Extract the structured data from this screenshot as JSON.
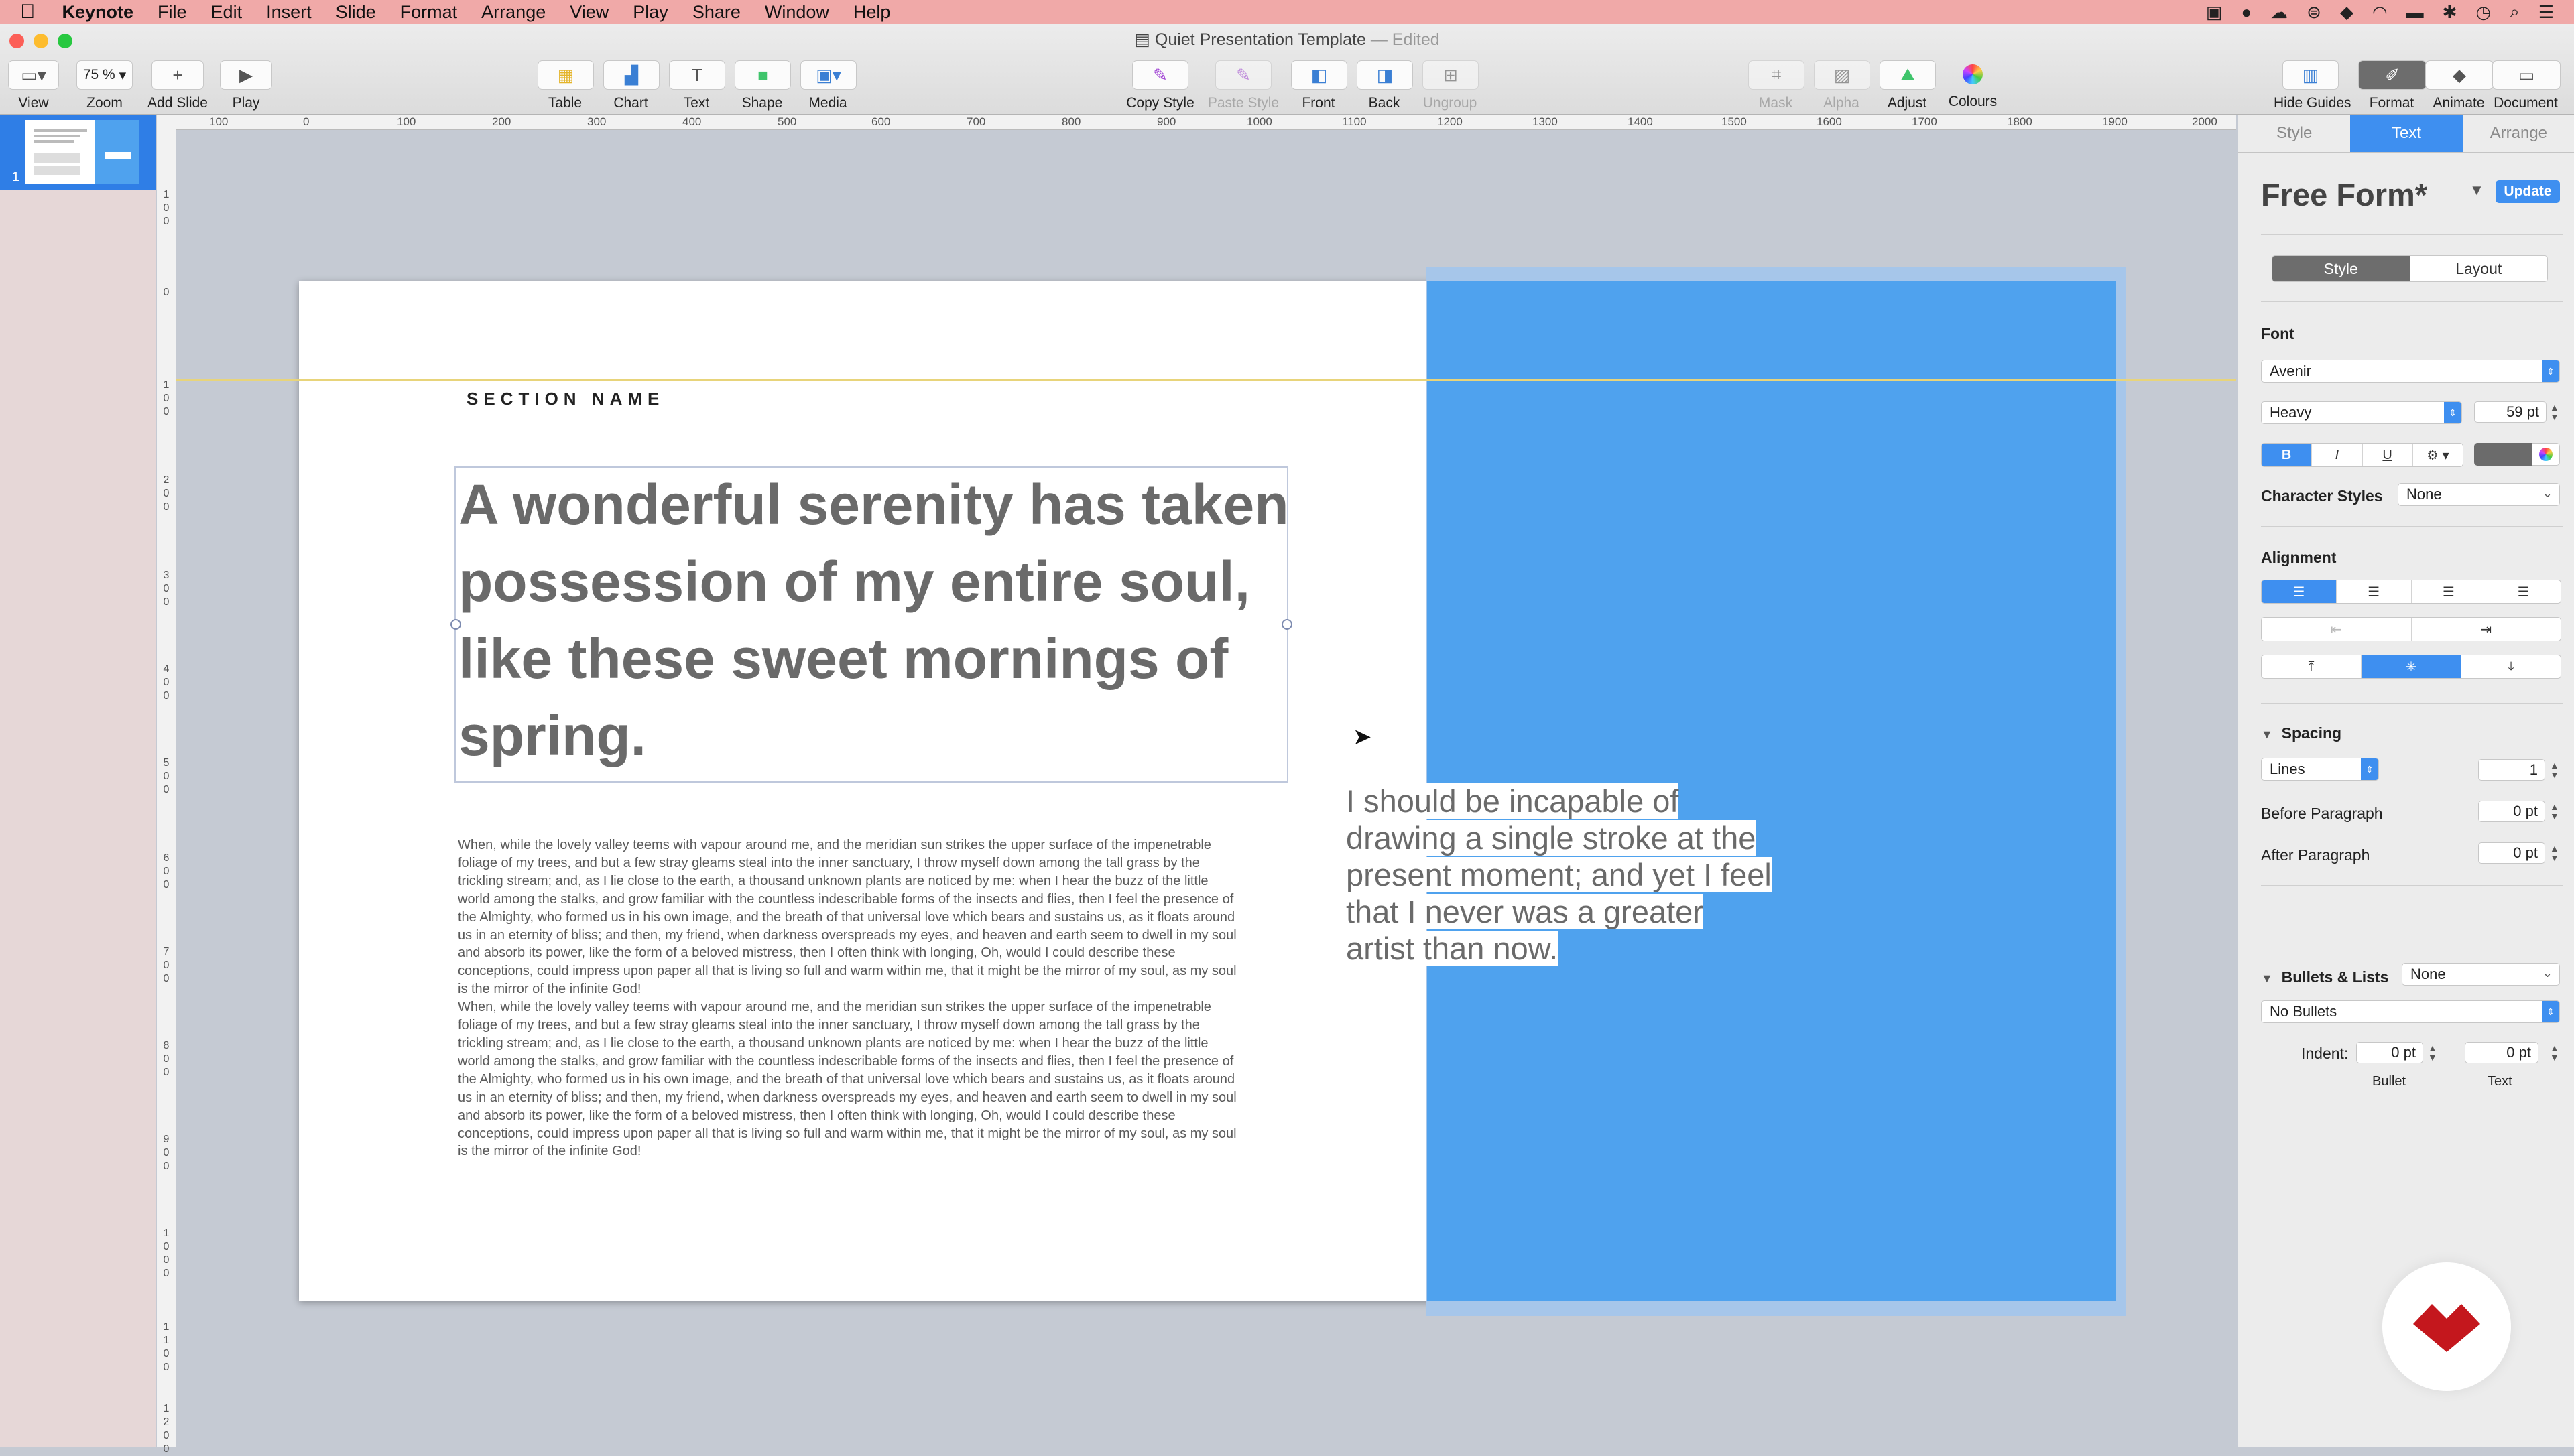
{
  "menubar": {
    "app_name": "Keynote",
    "items": [
      "File",
      "Edit",
      "Insert",
      "Slide",
      "Format",
      "Arrange",
      "View",
      "Play",
      "Share",
      "Window",
      "Help"
    ]
  },
  "window": {
    "title": "Quiet Presentation Template",
    "edited": "— Edited"
  },
  "toolbar": {
    "view": "View",
    "zoom": "Zoom",
    "zoom_value": "75 %",
    "add_slide": "Add Slide",
    "play": "Play",
    "table": "Table",
    "chart": "Chart",
    "text": "Text",
    "shape": "Shape",
    "media": "Media",
    "copy_style": "Copy Style",
    "paste_style": "Paste Style",
    "front": "Front",
    "back": "Back",
    "ungroup": "Ungroup",
    "mask": "Mask",
    "alpha": "Alpha",
    "adjust": "Adjust",
    "colours": "Colours",
    "hide_guides": "Hide Guides",
    "format": "Format",
    "animate": "Animate",
    "document": "Document",
    "text_glyph": "T"
  },
  "navigator": {
    "slide_number": "1"
  },
  "rulers": {
    "h_ticks": [
      "100",
      "0",
      "100",
      "200",
      "300",
      "400",
      "500",
      "600",
      "700",
      "800",
      "900",
      "1000",
      "1100",
      "1200",
      "1300",
      "1400",
      "1500",
      "1600",
      "1700",
      "1800",
      "1900",
      "2000"
    ],
    "v_ticks": [
      "100",
      "0",
      "100",
      "200",
      "300",
      "400",
      "500",
      "600",
      "700",
      "800",
      "900",
      "1000",
      "1100",
      "1200"
    ]
  },
  "slide": {
    "section_name": "SECTION NAME",
    "headline": "A wonderful serenity has taken possession of my entire soul, like these sweet mornings of spring.",
    "body_paragraphs": [
      "When, while the lovely valley teems with vapour around me, and the meridian sun strikes the upper surface of the impenetrable foliage of my trees, and but a few stray gleams steal into the inner sanctuary, I throw myself down among the tall grass by the trickling stream; and, as I lie close to the earth, a thousand unknown plants are noticed by me: when I hear the buzz of the little world among the stalks, and grow familiar with the countless indescribable forms of the insects and flies, then I feel the presence of the Almighty, who formed us in his own image, and the breath of that universal love which bears and sustains us, as it floats around us in an eternity of bliss; and then, my friend, when darkness overspreads my eyes, and heaven and earth seem to dwell in my soul and absorb its power, like the form of a beloved mistress, then I often think with longing, Oh, would I could describe these conceptions, could impress upon paper all that is living so full and warm within me, that it might be the mirror of my soul, as my soul is the mirror of the infinite God!",
      "When, while the lovely valley teems with vapour around me, and the meridian sun strikes the upper surface of the impenetrable foliage of my trees, and but a few stray gleams steal into the inner sanctuary, I throw myself down among the tall grass by the trickling stream; and, as I lie close to the earth, a thousand unknown plants are noticed by me: when I hear the buzz of the little world among the stalks, and grow familiar with the countless indescribable forms of the insects and flies, then I feel the presence of the Almighty, who formed us in his own image, and the breath of that universal love which bears and sustains us, as it floats around us in an eternity of bliss; and then, my friend, when darkness overspreads my eyes, and heaven and earth seem to dwell in my soul and absorb its power, like the form of a beloved mistress, then I often think with longing, Oh, would I could describe these conceptions, could impress upon paper all that is living so full and warm within me, that it might be the mirror of my soul, as my soul is the mirror of the infinite God!"
    ],
    "quote": "I should be incapable of drawing a single stroke at the present moment; and yet I feel that I never was a greater artist than now.",
    "accent_color": "#4fa2ee"
  },
  "inspector": {
    "tabs": [
      "Style",
      "Text",
      "Arrange"
    ],
    "active_tab": "Text",
    "paragraph_style": "Free Form*",
    "update_button": "Update",
    "subtabs": [
      "Style",
      "Layout"
    ],
    "font_label": "Font",
    "font_family": "Avenir",
    "font_weight": "Heavy",
    "font_size": "59 pt",
    "bold": "B",
    "italic": "I",
    "underline": "U",
    "gear": "⚙",
    "character_styles_label": "Character Styles",
    "character_styles_value": "None",
    "alignment_label": "Alignment",
    "spacing_label": "Spacing",
    "spacing_mode": "Lines",
    "spacing_value": "1",
    "before_paragraph_label": "Before Paragraph",
    "before_paragraph_value": "0 pt",
    "after_paragraph_label": "After Paragraph",
    "after_paragraph_value": "0 pt",
    "bullets_label": "Bullets & Lists",
    "bullets_value": "None",
    "bullets_style": "No Bullets",
    "indent_label": "Indent:",
    "indent_bullet_value": "0 pt",
    "indent_text_value": "0 pt",
    "indent_bullet_label": "Bullet",
    "indent_text_label": "Text"
  }
}
